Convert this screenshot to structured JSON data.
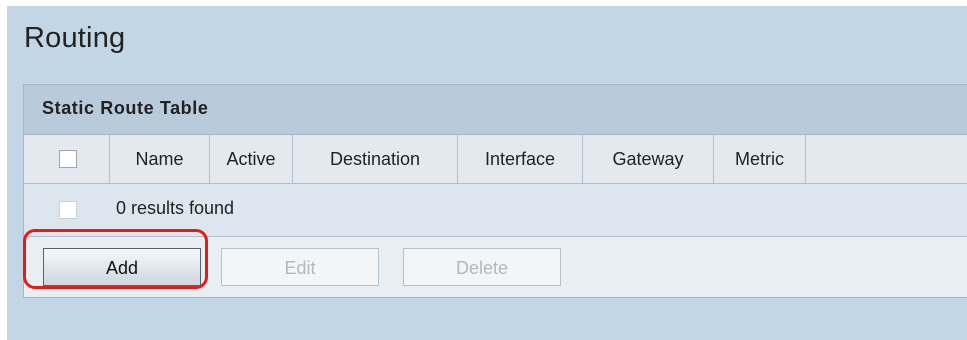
{
  "page": {
    "title": "Routing"
  },
  "table": {
    "title": "Static Route Table",
    "columns": [
      "Name",
      "Active",
      "Destination",
      "Interface",
      "Gateway",
      "Metric"
    ],
    "empty_message": "0 results found"
  },
  "buttons": {
    "add": "Add",
    "edit": "Edit",
    "delete": "Delete"
  },
  "colors": {
    "page_background": "#c3d6e6",
    "highlight": "#e51b1b"
  }
}
